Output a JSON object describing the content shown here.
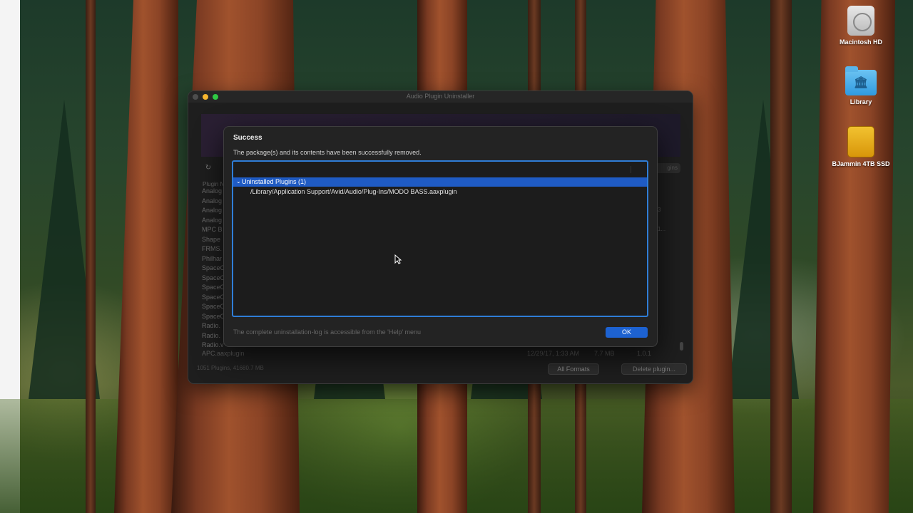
{
  "desktop": {
    "icons": [
      {
        "label": "Macintosh HD",
        "icon": "hard-drive-icon"
      },
      {
        "label": "Library",
        "icon": "library-folder-icon"
      },
      {
        "label": "BJammin 4TB SSD",
        "icon": "external-drive-icon"
      }
    ]
  },
  "window": {
    "title": "Audio Plugin Uninstaller",
    "toolbar": {
      "search_placeholder": "gins"
    },
    "column_header": "Plugin N",
    "plugins": [
      "Analog",
      "Analog",
      "Analog",
      "Analog",
      "MPC B",
      "Shape",
      "FRMS.",
      "Philhar",
      "SpaceC",
      "SpaceC",
      "SpaceC",
      "SpaceC",
      "SpaceC",
      "SpaceC",
      "Radio.",
      "Radio.",
      "Radio.v"
    ],
    "right_values": [
      "3",
      "1..."
    ],
    "last_row": {
      "name": "APC.aaxplugin",
      "date": "12/29/17, 1:33 AM",
      "size": "7.7 MB",
      "version": "1.0.1"
    },
    "status_text": "1051 Plugins, 41680.7 MB",
    "format_filter": "All Formats",
    "delete_button": "Delete plugin..."
  },
  "dialog": {
    "title": "Success",
    "message": "The package(s) and its contents have been successfully removed.",
    "group_label": "Uninstalled Plugins (1)",
    "items": [
      "/Library/Application Support/Avid/Audio/Plug-Ins/MODO BASS.aaxplugin"
    ],
    "footer": "The complete uninstallation-log is accessible from the 'Help' menu",
    "ok_label": "OK"
  }
}
